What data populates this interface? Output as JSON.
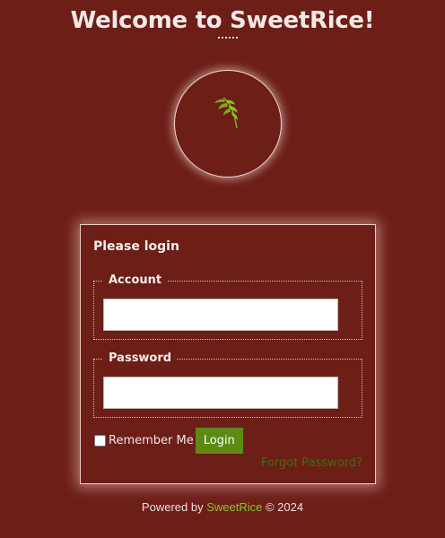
{
  "header": {
    "title": "Welcome to SweetRice!"
  },
  "logo": {
    "icon": "rice-stalk-icon",
    "color": "#7aab1f"
  },
  "login_panel": {
    "heading": "Please login",
    "account": {
      "legend": "Account",
      "value": "",
      "placeholder": ""
    },
    "password": {
      "legend": "Password",
      "value": "",
      "placeholder": ""
    },
    "remember_me": {
      "label": "Remember Me",
      "checked": false
    },
    "login_button": "Login",
    "forgot_password": "Forgot Password?"
  },
  "footer": {
    "prefix": "Powered by ",
    "link": "SweetRice",
    "suffix": " © 2024"
  },
  "colors": {
    "background": "#6d1e17",
    "button": "#5d8a14",
    "link": "#8cc434",
    "forgot_link": "#3d6e12"
  }
}
